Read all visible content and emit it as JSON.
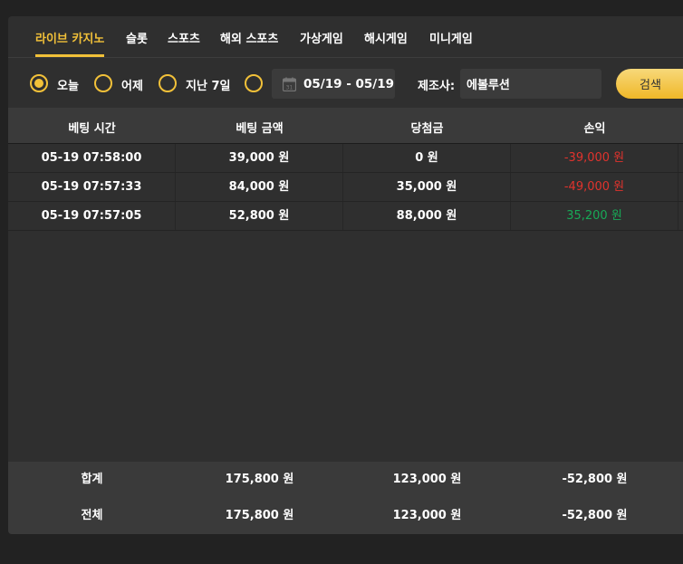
{
  "tabs": [
    {
      "label": "라이브 카지노",
      "active": true
    },
    {
      "label": "슬롯"
    },
    {
      "label": "스포츠"
    },
    {
      "label": "해외 스포츠"
    },
    {
      "label": "가상게임"
    },
    {
      "label": "해시게임"
    },
    {
      "label": "미니게임"
    }
  ],
  "filters": {
    "options": [
      {
        "label": "오늘",
        "checked": true
      },
      {
        "label": "어제"
      },
      {
        "label": "지난 7일"
      },
      {
        "label": ""
      }
    ],
    "date_range": "05/19 - 05/19",
    "date_icon_text": "31",
    "maker_label": "제조사:",
    "maker_value": "에볼루션",
    "search_label": "검색"
  },
  "table": {
    "headers": [
      "베팅 시간",
      "베팅 금액",
      "당첨금",
      "손익"
    ],
    "rows": [
      {
        "time": "05-19 07:58:00",
        "bet": "39,000 원",
        "win": "0 원",
        "profit": "-39,000 원",
        "profit_sign": "neg"
      },
      {
        "time": "05-19 07:57:33",
        "bet": "84,000 원",
        "win": "35,000 원",
        "profit": "-49,000 원",
        "profit_sign": "neg"
      },
      {
        "time": "05-19 07:57:05",
        "bet": "52,800 원",
        "win": "88,000 원",
        "profit": "35,200 원",
        "profit_sign": "pos"
      }
    ],
    "summary": [
      {
        "label": "합계",
        "bet": "175,800 원",
        "win": "123,000 원",
        "profit": "-52,800 원"
      },
      {
        "label": "전체",
        "bet": "175,800 원",
        "win": "123,000 원",
        "profit": "-52,800 원"
      }
    ]
  },
  "colors": {
    "accent": "#f2c139",
    "negative": "#e0332d",
    "positive": "#18a957",
    "panel": "#2f2f2f",
    "header": "#3a3a3a"
  }
}
